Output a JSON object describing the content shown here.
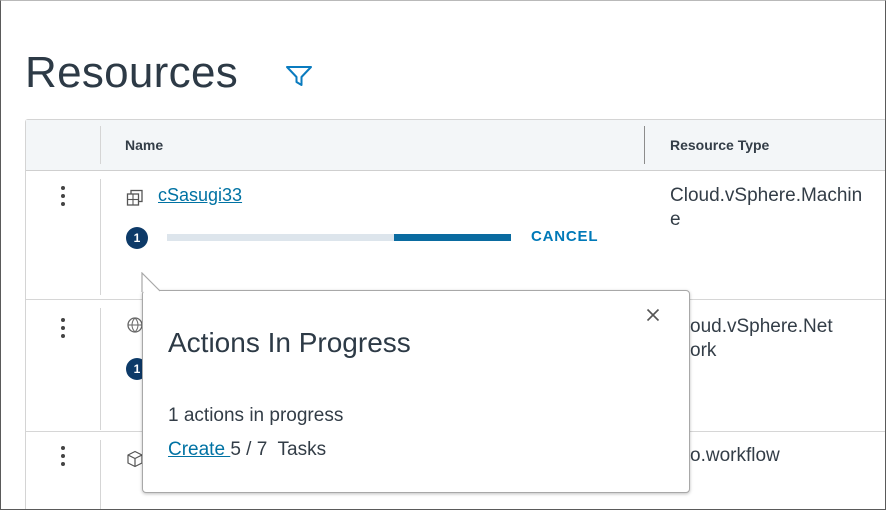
{
  "page": {
    "title": "Resources"
  },
  "grid": {
    "columns": [
      "Name",
      "Resource Type"
    ],
    "rows": [
      {
        "name": "cSasugi33",
        "resource_type": "Cloud.vSphere.Machine",
        "icon": "vm-icon",
        "actions_badge": "1",
        "progress": 0.34,
        "cancel_label": "CANCEL"
      },
      {
        "name": "",
        "resource_type": "Cloud.vSphere.Network",
        "visible_type_text": "oud.vSphere.Net\nork",
        "icon": "network-icon",
        "actions_badge": "1"
      },
      {
        "name": "",
        "resource_type": "",
        "visible_type_text": "o.workflow",
        "icon": "box-icon"
      }
    ]
  },
  "popover": {
    "title": "Actions In Progress",
    "summary": "1 actions in progress",
    "task_link": "Create ",
    "task_count": "5 / 7  Tasks"
  },
  "colors": {
    "accent": "#0072a3",
    "badge": "#0d3a68",
    "progress_fill": "#0a6ba0",
    "progress_track": "#dde5ec",
    "header_bg": "#f3f6f8"
  }
}
